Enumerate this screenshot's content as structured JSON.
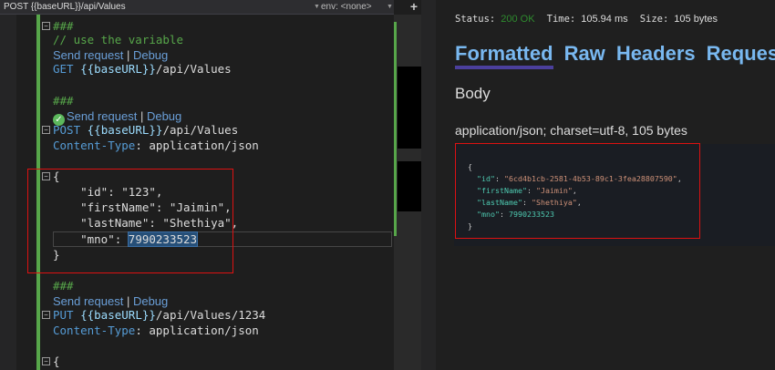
{
  "topbar": {
    "title": "POST {{baseURL}}/api/Values",
    "env": "env: <none>",
    "add": "+"
  },
  "editor": {
    "lines": [
      {
        "text": "###"
      },
      {
        "text": "// use the variable"
      },
      {
        "send": "Send request",
        "debug": "Debug"
      },
      {
        "method": "GET",
        "var": "{{baseURL}}",
        "path": "/api/Values"
      },
      {
        "text": "###"
      },
      {
        "send": "Send request",
        "debug": "Debug"
      },
      {
        "method": "POST",
        "var": "{{baseURL}}",
        "path": "/api/Values"
      },
      {
        "header": "Content-Type",
        "value": ": application/json"
      },
      {
        "text": "{"
      },
      {
        "text": "    \"id\": \"123\","
      },
      {
        "text": "    \"firstName\": \"Jaimin\","
      },
      {
        "text": "    \"lastName\": \"Shethiya\","
      },
      {
        "prefix": "    \"mno\": ",
        "sel": "7990233523"
      },
      {
        "text": "}"
      },
      {
        "text": "###"
      },
      {
        "send": "Send request",
        "debug": "Debug"
      },
      {
        "method": "PUT",
        "var": "{{baseURL}}",
        "path": "/api/Values/1234"
      },
      {
        "header": "Content-Type",
        "value": ": application/json"
      },
      {
        "text": "{"
      }
    ]
  },
  "response": {
    "status_label": "Status:",
    "status": "200 OK",
    "time_label": "Time:",
    "time": "105.94 ms",
    "size_label": "Size:",
    "size": "105 bytes",
    "tabs": [
      "Formatted",
      "Raw",
      "Headers",
      "Request"
    ],
    "body_heading": "Body",
    "content_type": "application/json; charset=utf-8, 105 bytes",
    "json": {
      "open": "{",
      "id_key": "\"id\"",
      "id": "\"6cd4b1cb-2581-4b53-89c1-3fea28807590\"",
      "fn_key": "\"firstName\"",
      "fn": "\"Jaimin\"",
      "ln_key": "\"lastName\"",
      "ln": "\"Shethiya\"",
      "mno_key": "\"mno\"",
      "mno": "7990233523",
      "close": "}"
    }
  }
}
